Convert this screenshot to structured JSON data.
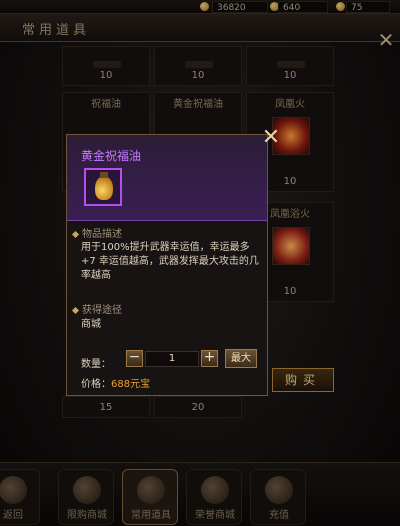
{
  "currency": {
    "gold": "36820",
    "yuanbao": "640",
    "bind": "75"
  },
  "window": {
    "title": "常用道具"
  },
  "grid": {
    "row1_counts": [
      "10",
      "10",
      "10"
    ],
    "row2": [
      {
        "name": "祝福油"
      },
      {
        "name": "黄金祝福油"
      },
      {
        "name": "凤凰火",
        "count": "10"
      }
    ],
    "row3": [
      {
        "name": "凤凰浴火",
        "count": "10"
      }
    ],
    "bottom_counts": [
      "15",
      "20"
    ]
  },
  "popup": {
    "item_name": "黄金祝福油",
    "section_desc": "物品描述",
    "description": "用于100%提升武器幸运值，幸运最多+7 幸运值越高，武器发挥最大攻击的几率越高",
    "section_source": "获得途径",
    "source": "商城",
    "qty_label": "数量：",
    "minus": "−",
    "qty_value": "1",
    "plus": "+",
    "max_label": "最大",
    "price_label": "价格：",
    "price_value": "688元宝",
    "close": "✕"
  },
  "buy_button": "购买",
  "nav": [
    {
      "label": "返回"
    },
    {
      "label": "限购商城"
    },
    {
      "label": "常用道具"
    },
    {
      "label": "荣誉商城"
    },
    {
      "label": "充值"
    }
  ],
  "colors": {
    "accent_purple": "#c77aff",
    "price_orange": "#f0a030",
    "gold_border": "#b2853b"
  }
}
